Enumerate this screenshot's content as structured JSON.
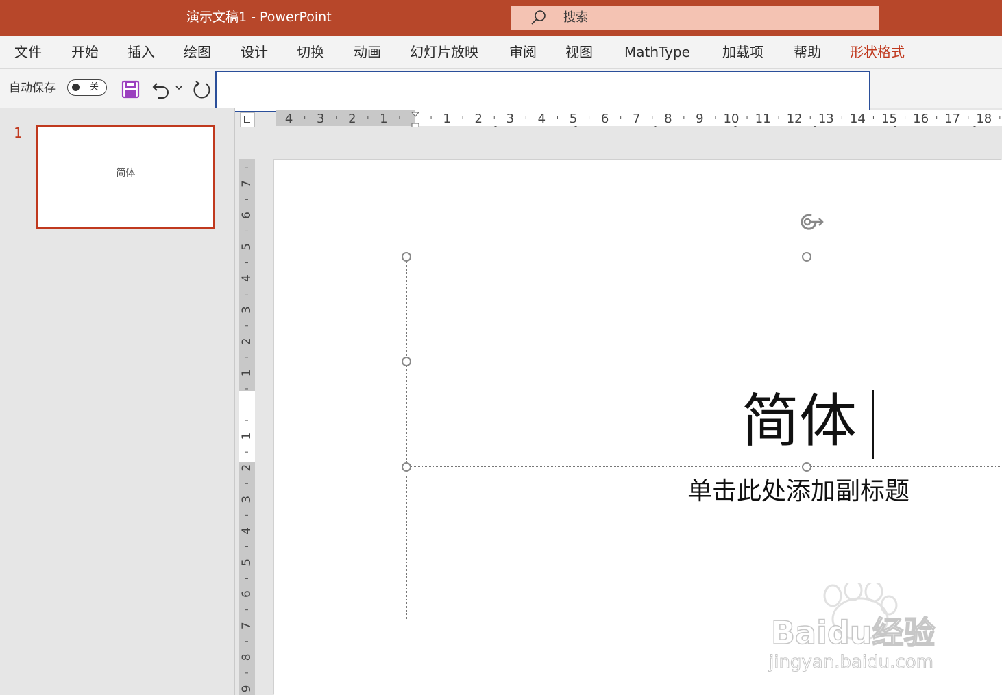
{
  "titlebar": {
    "title": "演示文稿1  -  PowerPoint",
    "search_placeholder": "搜索"
  },
  "ribbon": {
    "tabs": [
      {
        "label": "文件"
      },
      {
        "label": "开始"
      },
      {
        "label": "插入"
      },
      {
        "label": "绘图"
      },
      {
        "label": "设计"
      },
      {
        "label": "切换"
      },
      {
        "label": "动画"
      },
      {
        "label": "幻灯片放映"
      },
      {
        "label": "审阅"
      },
      {
        "label": "视图"
      },
      {
        "label": "MathType"
      },
      {
        "label": "加载项"
      },
      {
        "label": "帮助"
      },
      {
        "label": "形状格式",
        "active": true
      }
    ]
  },
  "quick_access": {
    "autosave_label": "自动保存",
    "autosave_state": "关",
    "icons": [
      "save-icon",
      "undo-icon",
      "undo-dropdown-icon",
      "redo-icon"
    ],
    "name_box_value": ""
  },
  "thumbnails": [
    {
      "number": "1",
      "text": "简体",
      "selected": true
    }
  ],
  "rulers": {
    "horizontal_labels": [
      "4",
      "3",
      "2",
      "1",
      "1",
      "2",
      "3",
      "4",
      "5",
      "6",
      "7",
      "8",
      "9",
      "10",
      "11",
      "12",
      "13",
      "14",
      "15",
      "16",
      "17",
      "18"
    ],
    "vertical_labels": [
      "7",
      "6",
      "5",
      "4",
      "3",
      "2",
      "1",
      "1",
      "2",
      "3",
      "4",
      "5",
      "6",
      "7",
      "8",
      "9"
    ]
  },
  "slide": {
    "title_text": "简体",
    "subtitle_placeholder": "单击此处添加副标题"
  },
  "watermark": {
    "brand": "Baidu经验",
    "url": "jingyan.baidu.com"
  },
  "colors": {
    "titlebar_bg": "#b7472a",
    "search_bg": "#f4c3b3",
    "active_tab": "#c0391e",
    "name_box_border": "#2b4f9a"
  }
}
